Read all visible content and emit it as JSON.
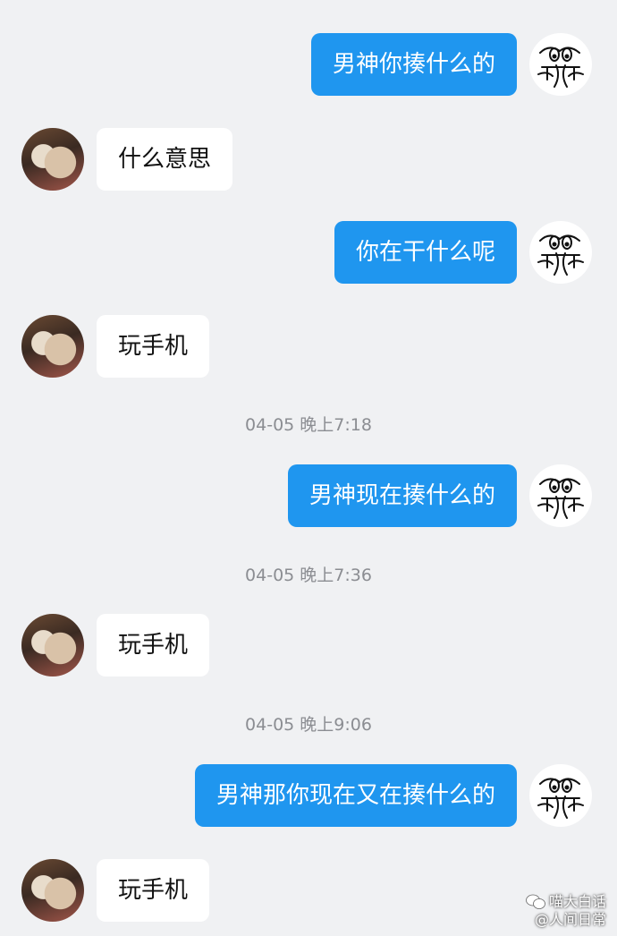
{
  "messages": [
    {
      "from": "me",
      "text": "男神你揍什么的"
    },
    {
      "from": "other",
      "text": "什么意思"
    },
    {
      "from": "me",
      "text": "你在干什么呢"
    },
    {
      "from": "other",
      "text": "玩手机"
    },
    {
      "timestamp": "04-05 晚上7:18"
    },
    {
      "from": "me",
      "text": "男神现在揍什么的"
    },
    {
      "timestamp": "04-05 晚上7:36"
    },
    {
      "from": "other",
      "text": "玩手机"
    },
    {
      "timestamp": "04-05 晚上9:06"
    },
    {
      "from": "me",
      "text": "男神那你现在又在揍什么的"
    },
    {
      "from": "other",
      "text": "玩手机"
    }
  ],
  "watermark": {
    "account": "喵大白话",
    "handle": "@人间日常"
  },
  "icons": {
    "me_avatar": "squiggle-face-avatar",
    "other_avatar": "photo-avatar",
    "watermark_icon": "wechat-icon"
  },
  "colors": {
    "background": "#f0f1f3",
    "me_bubble": "#1f96ef",
    "other_bubble": "#ffffff",
    "timestamp_text": "#8b8d92"
  }
}
